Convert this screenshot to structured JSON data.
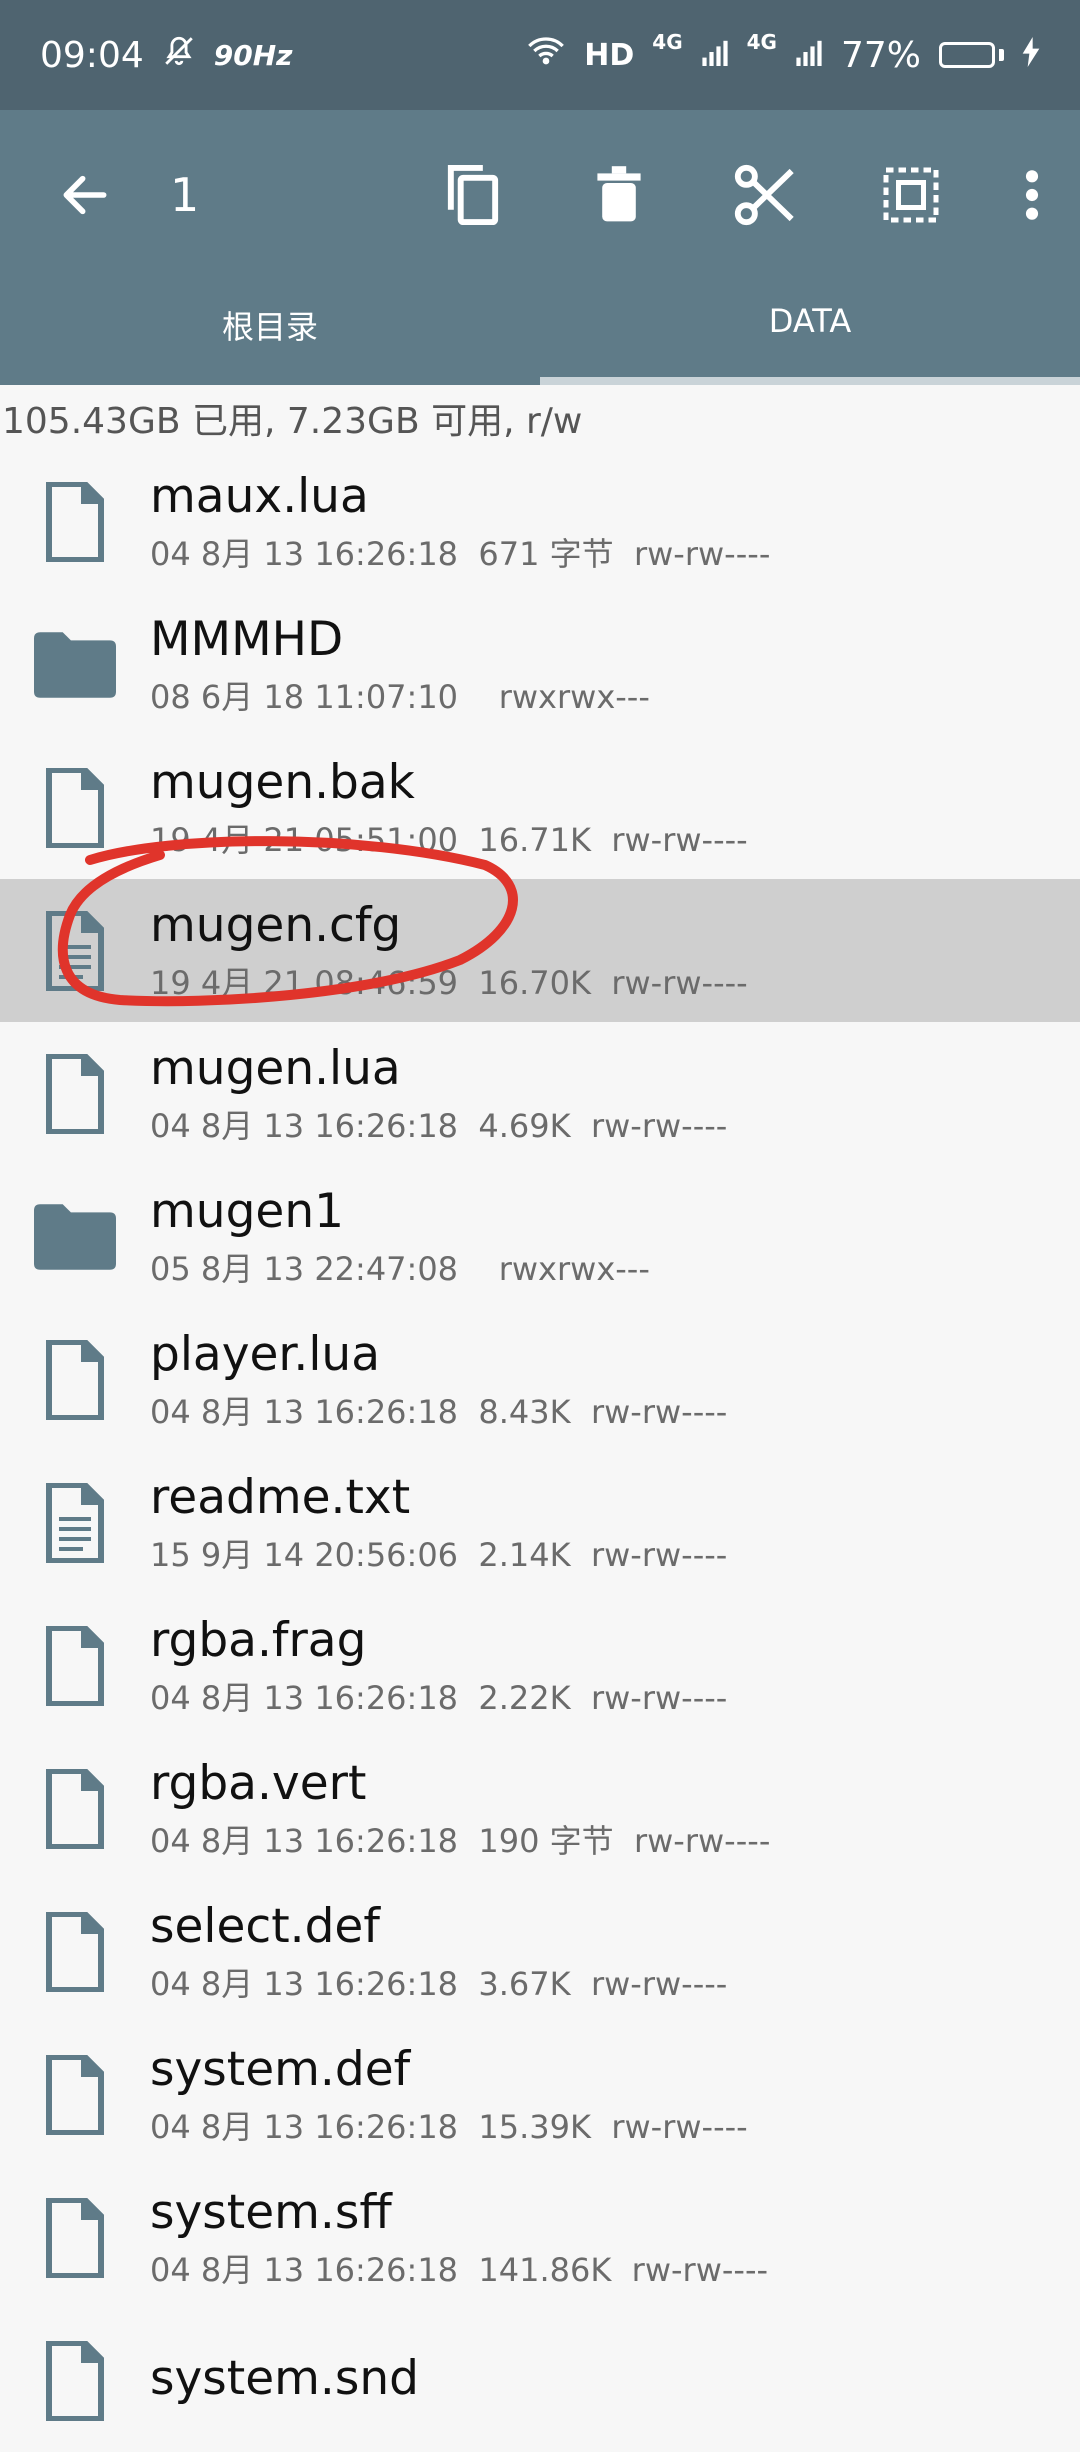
{
  "status_bar": {
    "time": "09:04",
    "refresh_rate": "90Hz",
    "hd_label": "HD",
    "net1": "4G",
    "net2": "4G",
    "battery": "77%",
    "battery_level": 0.77,
    "icons": [
      "mute-bell-icon",
      "wifi-icon",
      "signal-icon",
      "signal-icon",
      "battery-icon",
      "charging-icon"
    ]
  },
  "toolbar": {
    "selected_count": "1",
    "icons": [
      "back-arrow-icon",
      "copy-icon",
      "delete-icon",
      "cut-icon",
      "select-all-icon",
      "more-vert-icon"
    ]
  },
  "tabs": [
    {
      "label": "根目录",
      "active": false
    },
    {
      "label": "DATA",
      "active": true
    }
  ],
  "storage_info": "105.43GB 已用, 7.23GB 可用, r/w",
  "files": [
    {
      "name": "maux.lua",
      "meta": "04 8月 13 16:26:18  671 字节  rw-rw----",
      "type": "file"
    },
    {
      "name": "MMMHD",
      "meta": "08 6月 18 11:07:10    rwxrwx---",
      "type": "folder"
    },
    {
      "name": "mugen.bak",
      "meta": "19 4月 21 05:51:00  16.71K  rw-rw----",
      "type": "file"
    },
    {
      "name": "mugen.cfg",
      "meta": "19 4月 21 08:46:59  16.70K  rw-rw----",
      "type": "text",
      "selected": true
    },
    {
      "name": "mugen.lua",
      "meta": "04 8月 13 16:26:18  4.69K  rw-rw----",
      "type": "file"
    },
    {
      "name": "mugen1",
      "meta": "05 8月 13 22:47:08    rwxrwx---",
      "type": "folder"
    },
    {
      "name": "player.lua",
      "meta": "04 8月 13 16:26:18  8.43K  rw-rw----",
      "type": "file"
    },
    {
      "name": "readme.txt",
      "meta": "15 9月 14 20:56:06  2.14K  rw-rw----",
      "type": "text"
    },
    {
      "name": "rgba.frag",
      "meta": "04 8月 13 16:26:18  2.22K  rw-rw----",
      "type": "file"
    },
    {
      "name": "rgba.vert",
      "meta": "04 8月 13 16:26:18  190 字节  rw-rw----",
      "type": "file"
    },
    {
      "name": "select.def",
      "meta": "04 8月 13 16:26:18  3.67K  rw-rw----",
      "type": "file"
    },
    {
      "name": "system.def",
      "meta": "04 8月 13 16:26:18  15.39K  rw-rw----",
      "type": "file"
    },
    {
      "name": "system.sff",
      "meta": "04 8月 13 16:26:18  141.86K  rw-rw----",
      "type": "file"
    },
    {
      "name": "system.snd",
      "meta": "",
      "type": "file"
    }
  ],
  "colors": {
    "primary": "#5f7b88",
    "status": "#4f6470",
    "icon": "#5f7b88",
    "selected_row": "#cfcfcf",
    "annotation": "#e0342b"
  }
}
